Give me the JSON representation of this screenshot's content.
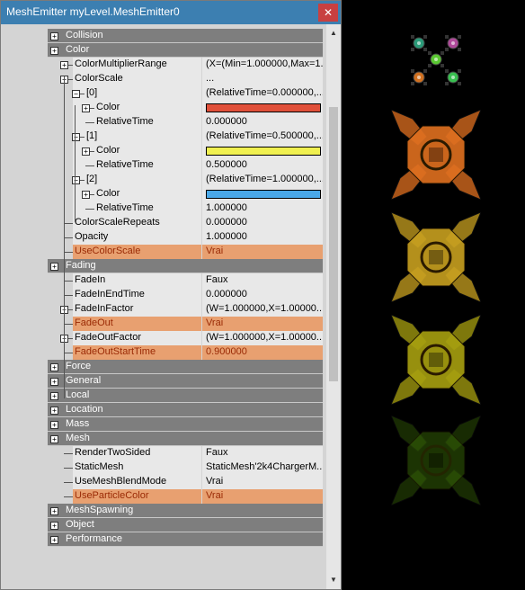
{
  "window": {
    "title": "MeshEmitter myLevel.MeshEmitter0",
    "close_icon": "close-icon"
  },
  "categories": {
    "collision": "Collision",
    "color": "Color",
    "fading": "Fading",
    "force": "Force",
    "general": "General",
    "local": "Local",
    "location": "Location",
    "mass": "Mass",
    "mesh": "Mesh",
    "meshspawning": "MeshSpawning",
    "object": "Object",
    "performance": "Performance"
  },
  "props": {
    "color_multiplier_range": {
      "name": "ColorMultiplierRange",
      "value": "(X=(Min=1.000000,Max=1..."
    },
    "color_scale": {
      "name": "ColorScale",
      "value": "..."
    },
    "cs0": {
      "name": "[0]",
      "value": "(RelativeTime=0.000000,..."
    },
    "cs0_color": {
      "name": "Color",
      "swatch": "#e0503a"
    },
    "cs0_time": {
      "name": "RelativeTime",
      "value": "0.000000"
    },
    "cs1": {
      "name": "[1]",
      "value": "(RelativeTime=0.500000,..."
    },
    "cs1_color": {
      "name": "Color",
      "swatch": "#f0f050"
    },
    "cs1_time": {
      "name": "RelativeTime",
      "value": "0.500000"
    },
    "cs2": {
      "name": "[2]",
      "value": "(RelativeTime=1.000000,..."
    },
    "cs2_color": {
      "name": "Color",
      "swatch": "#4aa8e8"
    },
    "cs2_time": {
      "name": "RelativeTime",
      "value": "1.000000"
    },
    "color_scale_repeats": {
      "name": "ColorScaleRepeats",
      "value": "0.000000"
    },
    "opacity": {
      "name": "Opacity",
      "value": "1.000000"
    },
    "use_color_scale": {
      "name": "UseColorScale",
      "value": "Vrai"
    },
    "fade_in": {
      "name": "FadeIn",
      "value": "Faux"
    },
    "fade_in_end_time": {
      "name": "FadeInEndTime",
      "value": "0.000000"
    },
    "fade_in_factor": {
      "name": "FadeInFactor",
      "value": "(W=1.000000,X=1.00000..."
    },
    "fade_out": {
      "name": "FadeOut",
      "value": "Vrai"
    },
    "fade_out_factor": {
      "name": "FadeOutFactor",
      "value": "(W=1.000000,X=1.00000..."
    },
    "fade_out_start_time": {
      "name": "FadeOutStartTime",
      "value": "0.900000"
    },
    "render_two_sided": {
      "name": "RenderTwoSided",
      "value": "Faux"
    },
    "static_mesh": {
      "name": "StaticMesh",
      "value": "StaticMesh'2k4ChargerM..."
    },
    "use_mesh_blend_mode": {
      "name": "UseMeshBlendMode",
      "value": "Vrai"
    },
    "use_particle_color": {
      "name": "UseParticleColor",
      "value": "Vrai"
    }
  },
  "colors": {
    "highlight": "#e8a070",
    "titlebar": "#3c7fb1",
    "category": "#7e7e7e"
  },
  "preview": {
    "small_particle_colors": [
      "#2a9a78",
      "#b04a9a",
      "#5ac832",
      "#d07020",
      "#38c050"
    ],
    "large_particle_colors": [
      "#e07020",
      "#c8a020",
      "#a8a010",
      "#3a6a08"
    ]
  }
}
